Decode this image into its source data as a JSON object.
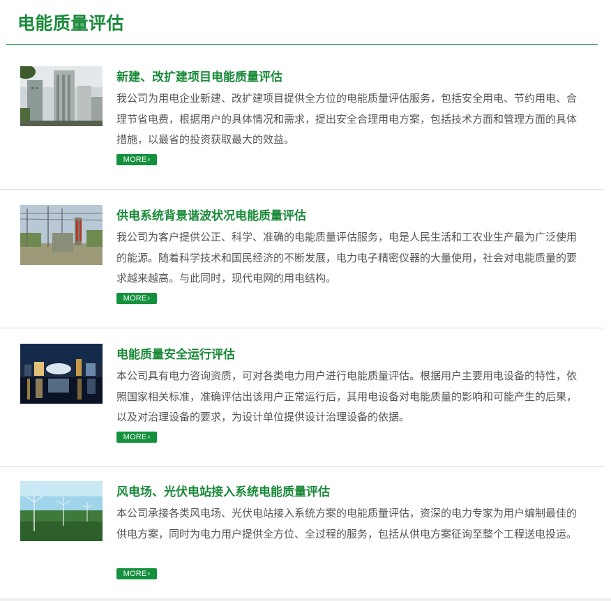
{
  "page": {
    "title": "电能质量评估"
  },
  "more_label": "MORE",
  "colors": {
    "accent": "#1a8a3a",
    "text": "#555555",
    "divider": "#dddddd"
  },
  "items": [
    {
      "title": "新建、改扩建项目电能质量评估",
      "description": "我公司为用电企业新建、改扩建项目提供全方位的电能质量评估服务，包括安全用电、节约用电、合理节省电费，根据用户的具体情况和需求，提出安全合理用电方案，包括技术方面和管理方面的具体措施，以最省的投资获取最大的效益。",
      "image": "city-buildings-photo"
    },
    {
      "title": "供电系统背景谐波状况电能质量评估",
      "description": "我公司为客户提供公正、科学、准确的电能质量评估服务，电是人民生活和工农业生产最为广泛使用的能源。随着科学技术和国民经济的不断发展，电力电子精密仪器的大量使用，社会对电能质量的要求越来越高。与此同时，现代电网的用电结构。",
      "image": "substation-photo"
    },
    {
      "title": "电能质量安全运行评估",
      "description": "本公司具有电力咨询资质，可对各类电力用户进行电能质量评估。根据用户主要用电设备的特性，依照国家相关标准，准确评估出该用户正常运行后，其用电设备对电能质量的影响和可能产生的后果，以及对治理设备的要求，为设计单位提供设计治理设备的依据。",
      "image": "night-city-photo"
    },
    {
      "title": "风电场、光伏电站接入系统电能质量评估",
      "description": "本公司承接各类风电场、光伏电站接入系统方案的电能质量评估，资深的电力专家为用户编制最佳的供电方案，同时为电力用户提供全方位、全过程的服务，包括从供电方案征询至整个工程送电投运。",
      "image": "wind-farm-photo"
    }
  ]
}
